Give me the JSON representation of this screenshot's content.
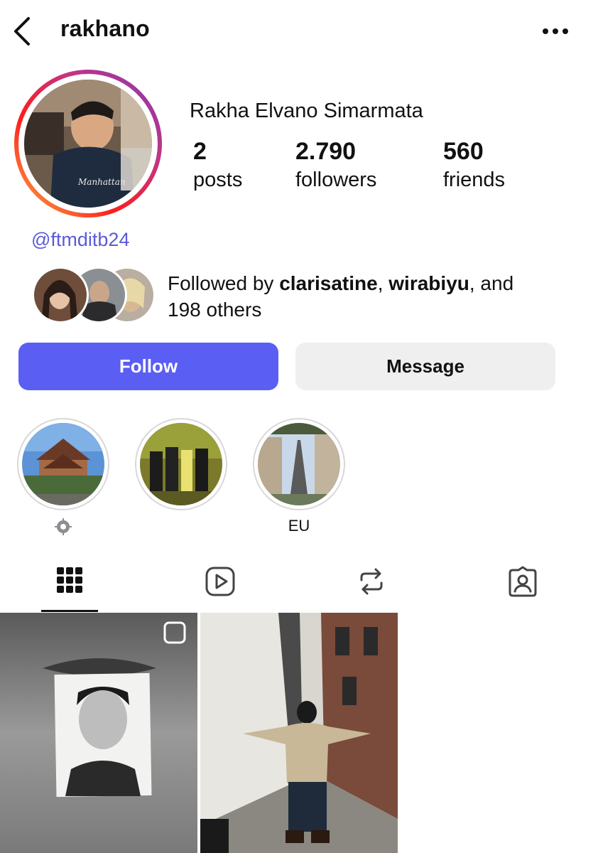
{
  "header": {
    "username": "rakhano"
  },
  "profile": {
    "display_name": "Rakha Elvano Simarmata",
    "handle": "@ftmditb24",
    "stats": {
      "posts": {
        "value": "2",
        "label": "posts"
      },
      "followers": {
        "value": "2.790",
        "label": "followers"
      },
      "friends": {
        "value": "560",
        "label": "friends"
      }
    },
    "followed_by": {
      "prefix": "Followed by ",
      "user1": "clarisatine",
      "sep": ", ",
      "user2": "wirabiyu",
      "mid": ", and",
      "rest": "198 others"
    }
  },
  "actions": {
    "follow_label": "Follow",
    "message_label": "Message"
  },
  "highlights": [
    {
      "label": "",
      "icon": "gear-icon"
    },
    {
      "label": ""
    },
    {
      "label": "EU"
    }
  ],
  "tabs": [
    {
      "icon": "grid-icon",
      "active": true
    },
    {
      "icon": "reels-icon"
    },
    {
      "icon": "repost-icon"
    },
    {
      "icon": "tagged-icon"
    }
  ],
  "colors": {
    "accent": "#5b5ef2",
    "handle": "#5b5bd6",
    "message_bg": "#efefef",
    "story_ring": [
      "#fcb045",
      "#fd1d1d",
      "#c13584",
      "#833ab4"
    ]
  }
}
